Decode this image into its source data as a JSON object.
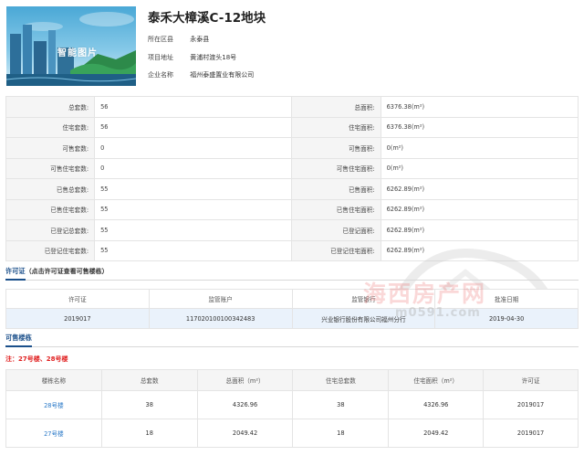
{
  "project": {
    "title": "泰禾大樟溪C-12地块",
    "thumb_logo": "智能图片",
    "info": [
      {
        "label": "所在区县",
        "value": "永泰县"
      },
      {
        "label": "项目地址",
        "value": "黄浦村渡头18号"
      },
      {
        "label": "企业名称",
        "value": "福州泰盛置业有限公司"
      }
    ]
  },
  "stats": [
    {
      "l1": "总套数:",
      "v1": "56",
      "l2": "总面积:",
      "v2": "6376.38(m²)"
    },
    {
      "l1": "住宅套数:",
      "v1": "56",
      "l2": "住宅面积:",
      "v2": "6376.38(m²)"
    },
    {
      "l1": "可售套数:",
      "v1": "0",
      "l2": "可售面积:",
      "v2": "0(m²)"
    },
    {
      "l1": "可售住宅套数:",
      "v1": "0",
      "l2": "可售住宅面积:",
      "v2": "0(m²)"
    },
    {
      "l1": "已售总套数:",
      "v1": "55",
      "l2": "已售面积:",
      "v2": "6262.89(m²)"
    },
    {
      "l1": "已售住宅套数:",
      "v1": "55",
      "l2": "已售住宅面积:",
      "v2": "6262.89(m²)"
    },
    {
      "l1": "已登记总套数:",
      "v1": "55",
      "l2": "已登记面积:",
      "v2": "6262.89(m²)"
    },
    {
      "l1": "已登记住宅套数:",
      "v1": "55",
      "l2": "已登记住宅面积:",
      "v2": "6262.89(m²)"
    }
  ],
  "permit_section": {
    "heading": "许可证",
    "hint": "（点击许可证查看可售楼栋）",
    "headers": [
      "许可证",
      "监管账户",
      "监管银行",
      "批准日期"
    ],
    "rows": [
      [
        "2019017",
        "117020100100342483",
        "兴业银行股份有限公司福州分行",
        "2019-04-30"
      ]
    ]
  },
  "watermark": {
    "text": "海西房产网",
    "sub": "m0591.com"
  },
  "buildings_section": {
    "heading": "可售楼栋",
    "note": "注：27号楼、28号楼",
    "headers": [
      "楼栋名称",
      "总套数",
      "总面积（m²）",
      "住宅总套数",
      "住宅面积（m²）",
      "许可证"
    ],
    "rows": [
      [
        "28号楼",
        "38",
        "4326.96",
        "38",
        "4326.96",
        "2019017"
      ],
      [
        "27号楼",
        "18",
        "2049.42",
        "18",
        "2049.42",
        "2019017"
      ]
    ]
  }
}
